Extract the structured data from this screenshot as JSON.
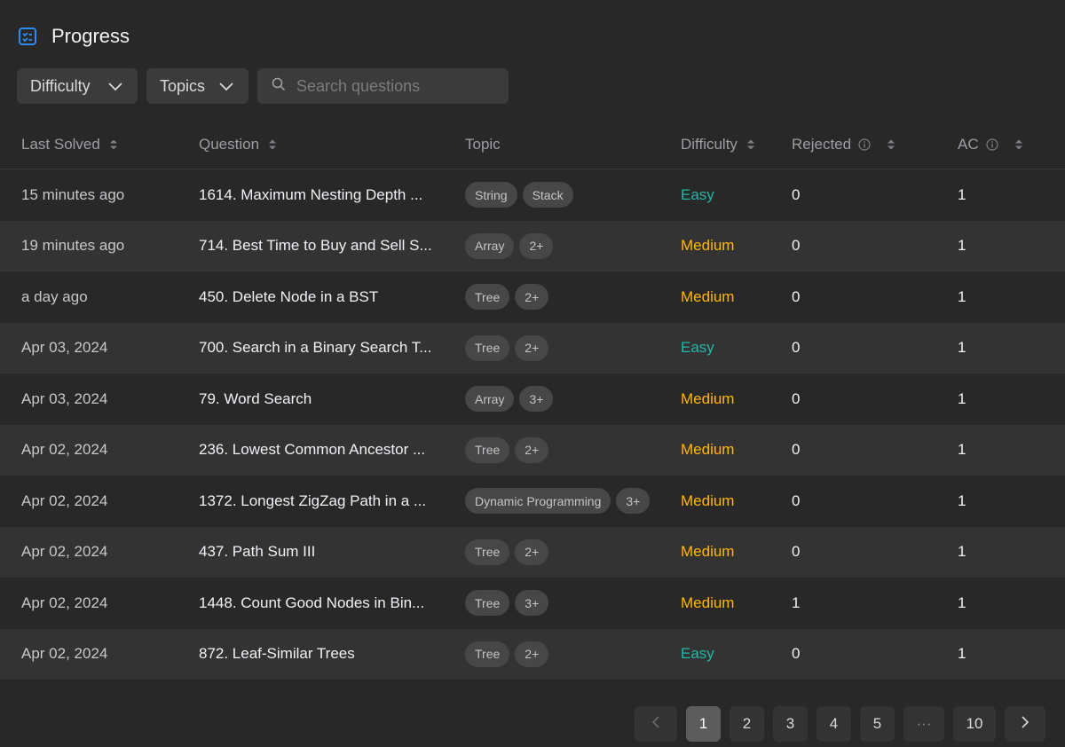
{
  "header": {
    "title": "Progress",
    "icon": "checklist-icon"
  },
  "filters": {
    "difficulty_label": "Difficulty",
    "topics_label": "Topics",
    "search_placeholder": "Search questions"
  },
  "columns": {
    "last_solved": "Last Solved",
    "question": "Question",
    "topic": "Topic",
    "difficulty": "Difficulty",
    "rejected": "Rejected",
    "ac": "AC"
  },
  "rows": [
    {
      "last_solved": "15 minutes ago",
      "question": "1614. Maximum Nesting Depth ...",
      "tags": [
        "String",
        "Stack"
      ],
      "difficulty": "Easy",
      "rejected": "0",
      "ac": "1"
    },
    {
      "last_solved": "19 minutes ago",
      "question": "714. Best Time to Buy and Sell S...",
      "tags": [
        "Array",
        "2+"
      ],
      "difficulty": "Medium",
      "rejected": "0",
      "ac": "1"
    },
    {
      "last_solved": "a day ago",
      "question": "450. Delete Node in a BST",
      "tags": [
        "Tree",
        "2+"
      ],
      "difficulty": "Medium",
      "rejected": "0",
      "ac": "1"
    },
    {
      "last_solved": "Apr 03, 2024",
      "question": "700. Search in a Binary Search T...",
      "tags": [
        "Tree",
        "2+"
      ],
      "difficulty": "Easy",
      "rejected": "0",
      "ac": "1"
    },
    {
      "last_solved": "Apr 03, 2024",
      "question": "79. Word Search",
      "tags": [
        "Array",
        "3+"
      ],
      "difficulty": "Medium",
      "rejected": "0",
      "ac": "1"
    },
    {
      "last_solved": "Apr 02, 2024",
      "question": "236. Lowest Common Ancestor ...",
      "tags": [
        "Tree",
        "2+"
      ],
      "difficulty": "Medium",
      "rejected": "0",
      "ac": "1"
    },
    {
      "last_solved": "Apr 02, 2024",
      "question": "1372. Longest ZigZag Path in a ...",
      "tags": [
        "Dynamic Programming",
        "3+"
      ],
      "difficulty": "Medium",
      "rejected": "0",
      "ac": "1"
    },
    {
      "last_solved": "Apr 02, 2024",
      "question": "437. Path Sum III",
      "tags": [
        "Tree",
        "2+"
      ],
      "difficulty": "Medium",
      "rejected": "0",
      "ac": "1"
    },
    {
      "last_solved": "Apr 02, 2024",
      "question": "1448. Count Good Nodes in Bin...",
      "tags": [
        "Tree",
        "3+"
      ],
      "difficulty": "Medium",
      "rejected": "1",
      "ac": "1"
    },
    {
      "last_solved": "Apr 02, 2024",
      "question": "872. Leaf-Similar Trees",
      "tags": [
        "Tree",
        "2+"
      ],
      "difficulty": "Easy",
      "rejected": "0",
      "ac": "1"
    }
  ],
  "pagination": {
    "pages": [
      "1",
      "2",
      "3",
      "4",
      "5"
    ],
    "ellipsis": "···",
    "last_page": "10",
    "current": "1"
  },
  "colors": {
    "easy": "#22b8a6",
    "medium": "#ffb800",
    "accent_icon": "#2e8cf0"
  }
}
